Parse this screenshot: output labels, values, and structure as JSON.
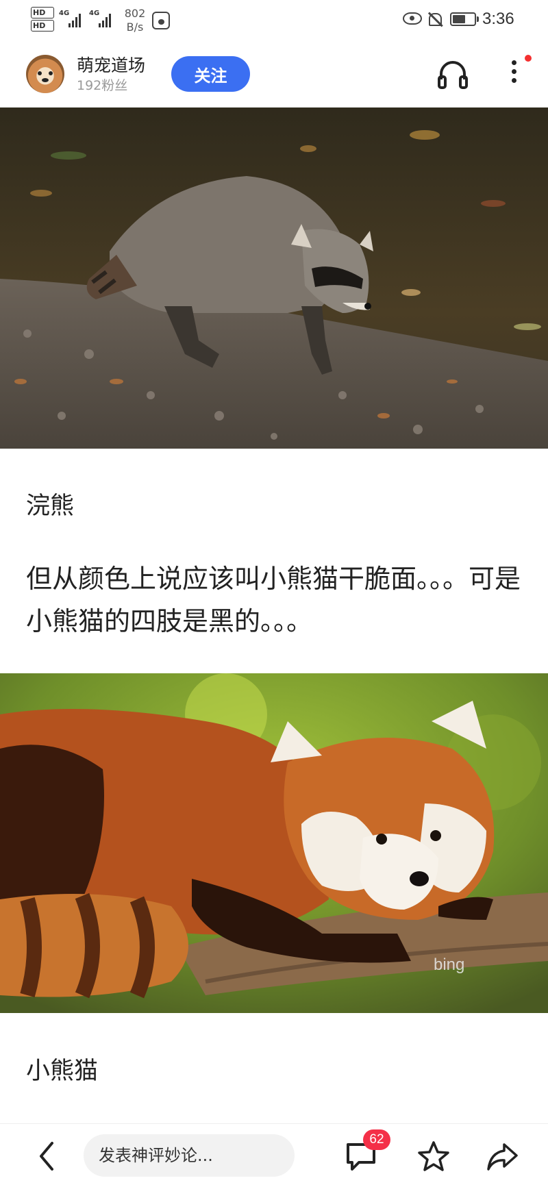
{
  "status_bar": {
    "hd1": "HD",
    "hd2": "HD",
    "net1": "4G",
    "net2": "4G",
    "speed_value": "802",
    "speed_unit": "B/s",
    "time": "3:36"
  },
  "author": {
    "name": "萌宠道场",
    "fans": "192粉丝",
    "follow_label": "关注"
  },
  "content": {
    "caption1": "浣熊",
    "paragraph": "但从颜色上说应该叫小熊猫干脆面。。。可是小熊猫的四肢是黑的。。。",
    "caption2": "小熊猫",
    "watermark": "bing"
  },
  "bottom_bar": {
    "comment_placeholder": "发表神评妙论...",
    "comment_count": "62"
  },
  "icons": [
    "eye-icon",
    "mute-bell-icon",
    "battery-icon",
    "headphone-icon",
    "more-icon",
    "back-icon",
    "comment-icon",
    "star-icon",
    "share-icon"
  ],
  "colors": {
    "follow_button": "#3b6ff2",
    "badge": "#f43048",
    "notify_dot": "#f43030"
  }
}
